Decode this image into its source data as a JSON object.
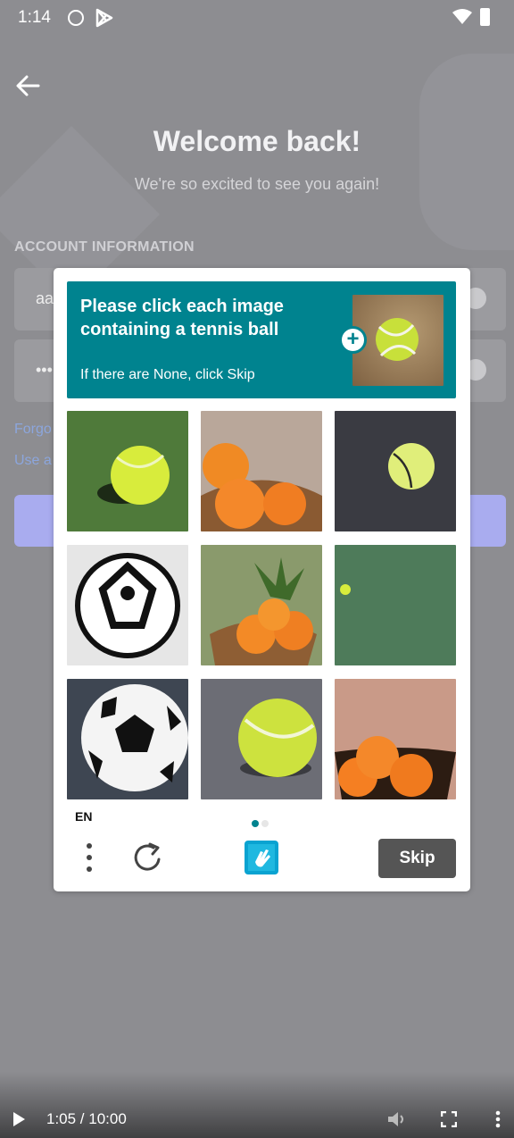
{
  "status_bar": {
    "time": "1:14"
  },
  "login": {
    "title": "Welcome back!",
    "subtitle": "We're so excited to see you again!",
    "section_label": "ACCOUNT INFORMATION",
    "username_value": "aa",
    "password_value": "•••",
    "forgot_link": "Forgo",
    "password_manager_link": "Use a"
  },
  "captcha": {
    "prompt_title": "Please click each image containing a tennis ball",
    "prompt_sub": "If there are None, click Skip",
    "example_icon": "plus-icon",
    "tiles": [
      {
        "name": "tennis-ball-on-grass"
      },
      {
        "name": "oranges-in-basket"
      },
      {
        "name": "tennis-ball-dark-background"
      },
      {
        "name": "black-white-ball"
      },
      {
        "name": "oranges-with-pineapple"
      },
      {
        "name": "small-tennis-ball-green"
      },
      {
        "name": "soccer-ball"
      },
      {
        "name": "tennis-ball-gray-surface"
      },
      {
        "name": "oranges-in-bowl"
      }
    ],
    "language": "EN",
    "skip_label": "Skip",
    "accent_color": "#00838f"
  },
  "video": {
    "time": "1:05 / 10:00"
  }
}
